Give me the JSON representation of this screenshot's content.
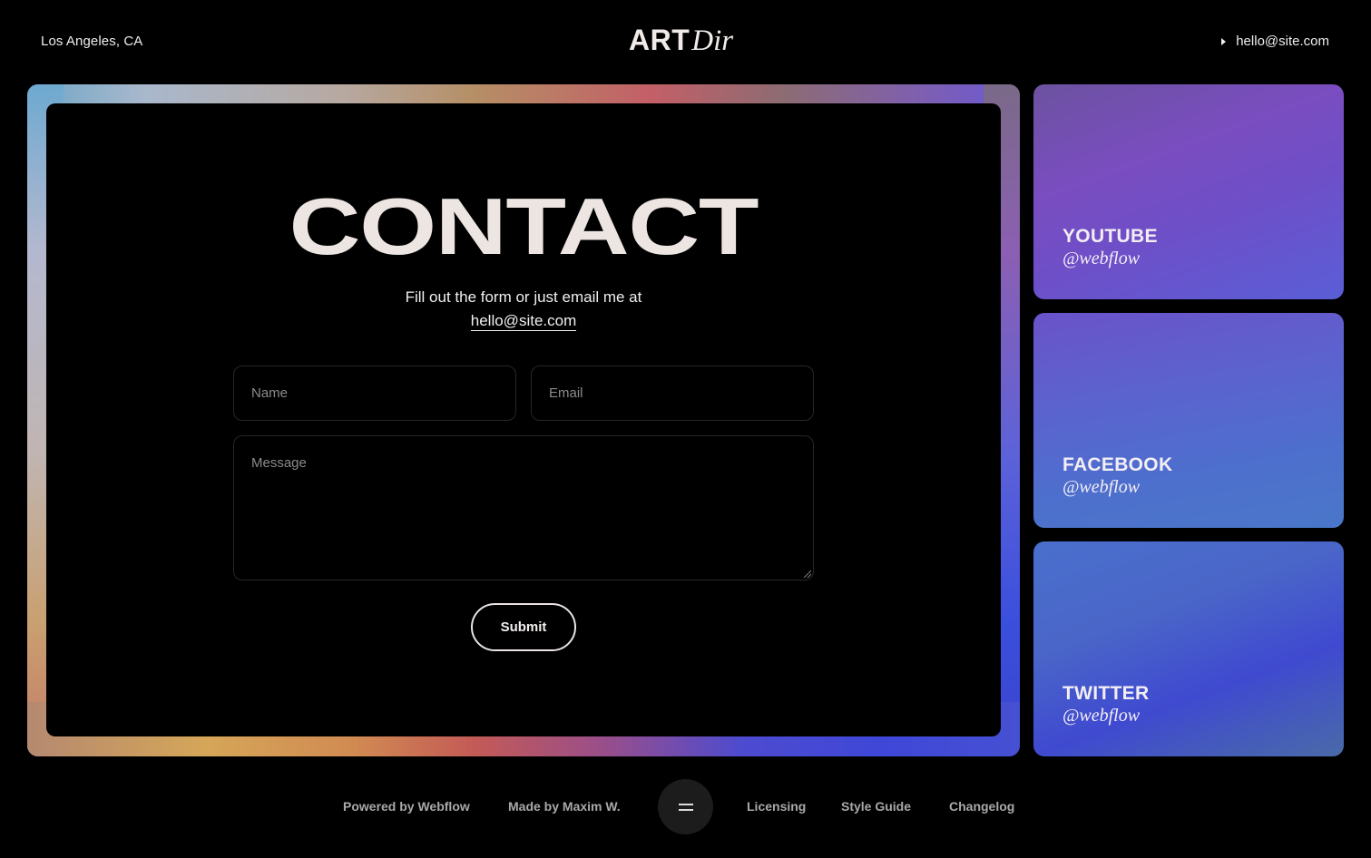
{
  "header": {
    "location": "Los Angeles, CA",
    "logo_bold": "ART",
    "logo_italic": "Dir",
    "email": "hello@site.com"
  },
  "contact": {
    "title": "CONTACT",
    "intro": "Fill out the form or just email me at",
    "email": "hello@site.com",
    "name_placeholder": "Name",
    "email_placeholder": "Email",
    "message_placeholder": "Message",
    "submit_label": "Submit"
  },
  "socials": [
    {
      "title": "YOUTUBE",
      "handle": "@webflow"
    },
    {
      "title": "FACEBOOK",
      "handle": "@webflow"
    },
    {
      "title": "TWITTER",
      "handle": "@webflow"
    }
  ],
  "footer": {
    "powered": "Powered by Webflow",
    "made_by": "Made by Maxim W.",
    "menu_icon": "menu-icon",
    "licensing": "Licensing",
    "style_guide": "Style Guide",
    "changelog": "Changelog"
  }
}
